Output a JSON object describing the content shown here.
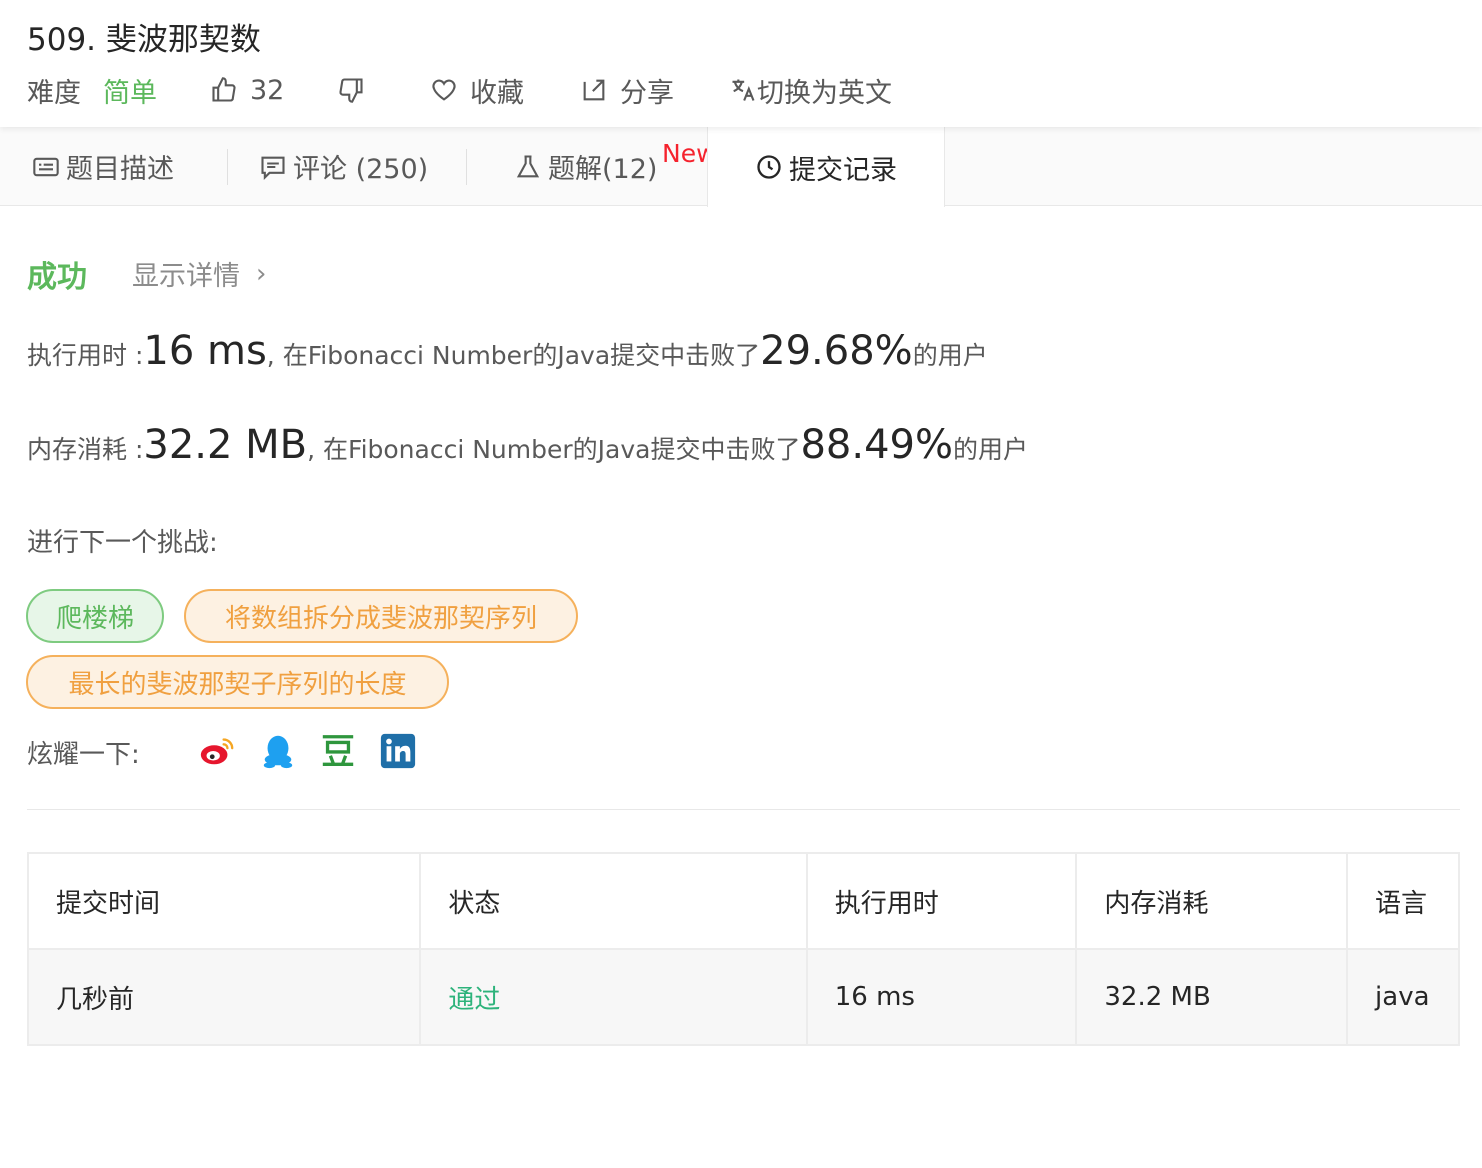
{
  "header": {
    "title": "509. 斐波那契数",
    "difficulty_label": "难度",
    "difficulty_value": "简单",
    "likes": "32",
    "favorite_label": "收藏",
    "share_label": "分享",
    "switch_lang_label": "切换为英文"
  },
  "tabs": [
    {
      "label": "题目描述",
      "icon": "description-icon"
    },
    {
      "label": "评论 (250)",
      "icon": "comment-icon"
    },
    {
      "label": "题解(12)",
      "icon": "flask-icon",
      "badge": "New"
    },
    {
      "label": "提交记录",
      "icon": "clock-icon",
      "active": true
    }
  ],
  "result": {
    "status": "成功",
    "detail_link": "显示详情",
    "runtime_label": "执行用时 : ",
    "runtime_value": "16 ms",
    "runtime_text": ", 在Fibonacci Number的Java提交中击败了",
    "runtime_percent": "29.68%",
    "suffix": " 的用户",
    "memory_label": "内存消耗 : ",
    "memory_value": "32.2 MB",
    "memory_text": ", 在Fibonacci Number的Java提交中击败了",
    "memory_percent": "88.49%"
  },
  "challenge": {
    "label": "进行下一个挑战:",
    "items": [
      "爬楼梯",
      "将数组拆分成斐波那契序列",
      "最长的斐波那契子序列的长度"
    ]
  },
  "share": {
    "label": "炫耀一下:",
    "icons": [
      "weibo-icon",
      "qq-icon",
      "douban-icon",
      "linkedin-icon"
    ]
  },
  "table": {
    "headers": [
      "提交时间",
      "状态",
      "执行用时",
      "内存消耗",
      "语言"
    ],
    "rows": [
      [
        "几秒前",
        "通过",
        "16 ms",
        "32.2 MB",
        "java"
      ]
    ]
  },
  "colors": {
    "success": "#5cb85c",
    "pass": "#2db37b",
    "new_badge": "#f5222d",
    "orange_pill": "#f0a040"
  }
}
